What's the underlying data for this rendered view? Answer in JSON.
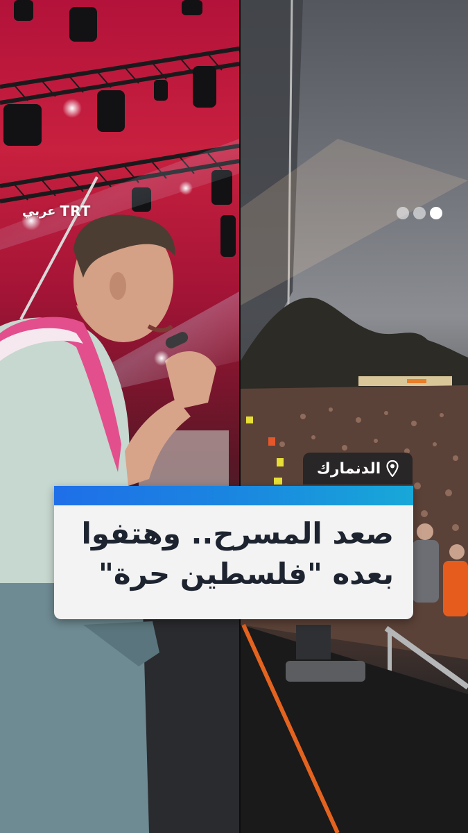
{
  "brand": {
    "logo_latin": "TRT",
    "logo_arabic": "عربي"
  },
  "carousel": {
    "total": 3,
    "active_index": 0
  },
  "location": {
    "label": "الدنمارك",
    "icon": "map-pin-icon"
  },
  "headline": {
    "line1": "صعد المسرح.. وهتفوا",
    "line2": "بعده \"فلسطين حرة\""
  },
  "colors": {
    "accent_gradient_start": "#1f6fe8",
    "accent_gradient_end": "#18a8d8",
    "headline_bg": "#f3f3f3",
    "headline_text": "#1d2430",
    "stage_red": "#c8203f"
  }
}
